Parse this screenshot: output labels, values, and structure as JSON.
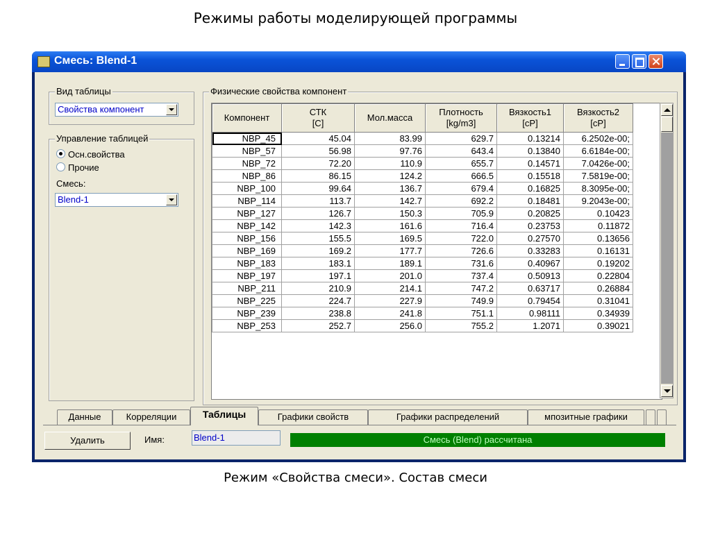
{
  "slide": {
    "title": "Режимы работы моделирующей программы",
    "caption": "Режим «Свойства смеси». Состав смеси"
  },
  "window": {
    "title": "Смесь: Blend-1"
  },
  "left": {
    "view_group": "Вид таблицы",
    "view_value": "Свойства компонент",
    "control_group": "Управление таблицей",
    "radio_main": "Осн.свойства",
    "radio_other": "Прочие",
    "mix_label": "Смесь:",
    "mix_value": "Blend-1"
  },
  "props_group": "Физические свойства компонент",
  "grid": {
    "headers": [
      "Компонент",
      "СТК\n[C]",
      "Мол.масса",
      "Плотность\n[kg/m3]",
      "Вязкость1\n[cP]",
      "Вязкость2\n[cP]"
    ],
    "rows": [
      [
        "NBP_45",
        "45.04",
        "83.99",
        "629.7",
        "0.13214",
        "6.2502e-00;"
      ],
      [
        "NBP_57",
        "56.98",
        "97.76",
        "643.4",
        "0.13840",
        "6.6184e-00;"
      ],
      [
        "NBP_72",
        "72.20",
        "110.9",
        "655.7",
        "0.14571",
        "7.0426e-00;"
      ],
      [
        "NBP_86",
        "86.15",
        "124.2",
        "666.5",
        "0.15518",
        "7.5819e-00;"
      ],
      [
        "NBP_100",
        "99.64",
        "136.7",
        "679.4",
        "0.16825",
        "8.3095e-00;"
      ],
      [
        "NBP_114",
        "113.7",
        "142.7",
        "692.2",
        "0.18481",
        "9.2043e-00;"
      ],
      [
        "NBP_127",
        "126.7",
        "150.3",
        "705.9",
        "0.20825",
        "0.10423"
      ],
      [
        "NBP_142",
        "142.3",
        "161.6",
        "716.4",
        "0.23753",
        "0.11872"
      ],
      [
        "NBP_156",
        "155.5",
        "169.5",
        "722.0",
        "0.27570",
        "0.13656"
      ],
      [
        "NBP_169",
        "169.2",
        "177.7",
        "726.6",
        "0.33283",
        "0.16131"
      ],
      [
        "NBP_183",
        "183.1",
        "189.1",
        "731.6",
        "0.40967",
        "0.19202"
      ],
      [
        "NBP_197",
        "197.1",
        "201.0",
        "737.4",
        "0.50913",
        "0.22804"
      ],
      [
        "NBP_211",
        "210.9",
        "214.1",
        "747.2",
        "0.63717",
        "0.26884"
      ],
      [
        "NBP_225",
        "224.7",
        "227.9",
        "749.9",
        "0.79454",
        "0.31041"
      ],
      [
        "NBP_239",
        "238.8",
        "241.8",
        "751.1",
        "0.98111",
        "0.34939"
      ],
      [
        "NBP_253",
        "252.7",
        "256.0",
        "755.2",
        "1.2071",
        "0.39021"
      ]
    ]
  },
  "tabs": [
    "Данные",
    "Корреляции",
    "Таблицы",
    "Графики свойств",
    "Графики распределений",
    "мпозитные графики"
  ],
  "active_tab": "Таблицы",
  "bottom": {
    "delete_button": "Удалить",
    "name_label": "Имя:",
    "name_value": "Blend-1",
    "status": "Смесь (Blend) рассчитана"
  }
}
